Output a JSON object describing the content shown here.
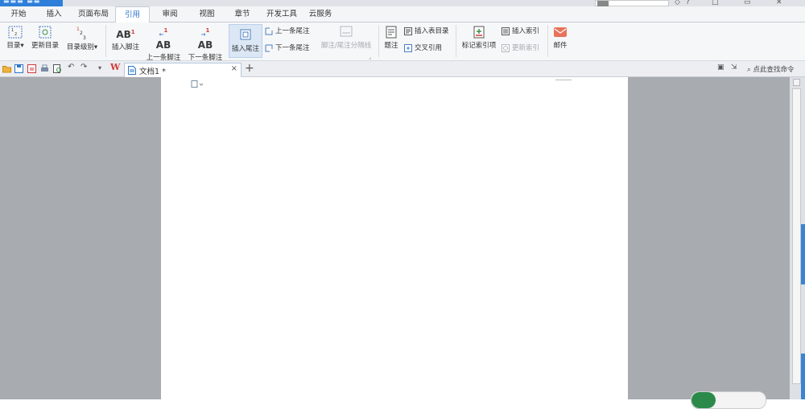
{
  "tabs": [
    "开始",
    "插入",
    "页面布局",
    "引用",
    "审阅",
    "视图",
    "章节",
    "开发工具",
    "云服务"
  ],
  "active_tab": "引用",
  "ribbon": {
    "toc": "目录",
    "update_toc": "更新目录",
    "toc_level": "目录级别",
    "insert_footnote": "插入脚注",
    "prev_footnote": "上一条脚注",
    "next_footnote": "下一条脚注",
    "insert_endnote": "插入尾注",
    "prev_endnote": "上一条尾注",
    "next_endnote": "下一条尾注",
    "separator_line": "脚注/尾注分隔线",
    "caption": "题注",
    "insert_table_of_figures": "插入表目录",
    "cross_reference": "交叉引用",
    "mark_index_entry": "标记索引项",
    "insert_index": "插入索引",
    "update_index": "更新索引",
    "mail": "邮件"
  },
  "document_tab": {
    "name": "文档1 *",
    "close": "×",
    "new": "+"
  },
  "command_search": "点此查找命令",
  "colors": {
    "accent": "#2e76c9",
    "workspace_bg": "#a8abb0",
    "page_bg": "#ffffff"
  }
}
